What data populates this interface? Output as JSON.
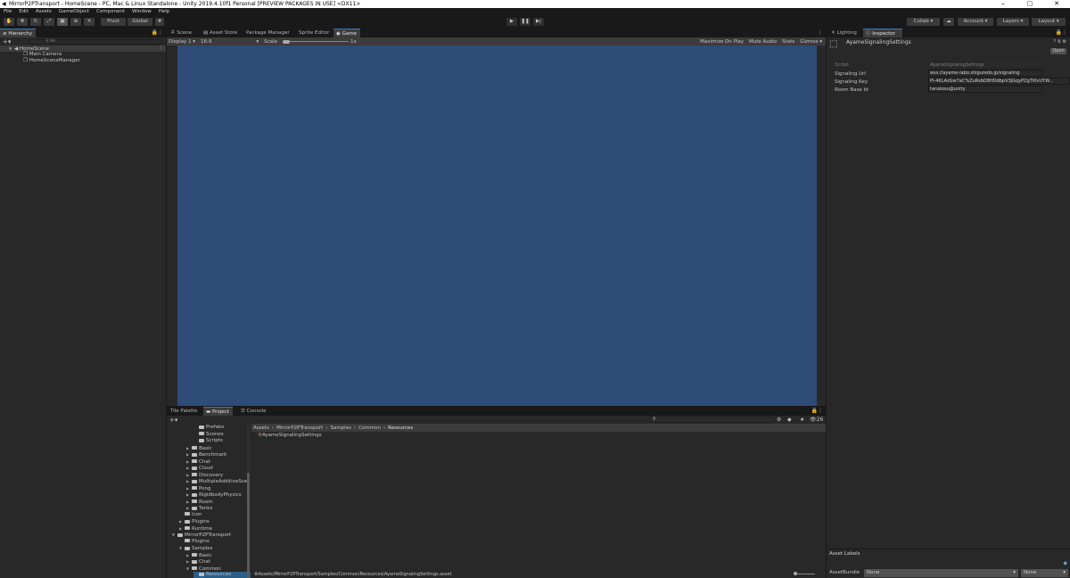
{
  "window": {
    "title": "MirrorP2PTransport - HomeScene - PC, Mac & Linux Standalone - Unity 2019.4.10f1 Personal [PREVIEW PACKAGES IN USE] <DX11>",
    "minimize": "‒",
    "maximize": "▢",
    "close": "✕"
  },
  "menu": [
    "File",
    "Edit",
    "Assets",
    "GameObject",
    "Component",
    "Window",
    "Help"
  ],
  "toolbar": {
    "pivot": "Pivot",
    "global": "Global",
    "collab": "Collab ▾",
    "account": "Account",
    "layers": "Layers",
    "layout": "Layout"
  },
  "hierarchy": {
    "tab": "Hierarchy",
    "search_placeholder": "All",
    "scene": "HomeScene",
    "items": [
      "Main Camera",
      "HomeSceneManager"
    ]
  },
  "center": {
    "tabs": [
      "Scene",
      "Asset Store",
      "Package Manager",
      "Sprite Editor",
      "Game"
    ],
    "display": "Display 1",
    "aspect": "16:9",
    "scale_label": "Scale",
    "scale_value": "1x",
    "options": [
      "Maximize On Play",
      "Mute Audio",
      "Stats",
      "Gizmos"
    ],
    "game_color": "#2f4b77"
  },
  "bottom": {
    "tabs": [
      "Tile Palette",
      "Project",
      "Console"
    ],
    "breadcrumb": [
      "Assets",
      "MirrorP2PTransport",
      "Samples",
      "Common",
      "Resources"
    ],
    "asset_item": "AyameSignalingSettings",
    "path": "Assets/MirrorP2PTransport/Samples/Common/Resources/AyameSignalingSettings.asset",
    "count": "26",
    "tree": [
      {
        "label": "Prefabs",
        "indent": 3,
        "arrow": ""
      },
      {
        "label": "Scenes",
        "indent": 3,
        "arrow": ""
      },
      {
        "label": "Scripts",
        "indent": 3,
        "arrow": ""
      },
      {
        "label": "Basic",
        "indent": 2,
        "arrow": "▶"
      },
      {
        "label": "Benchmark",
        "indent": 2,
        "arrow": "▶"
      },
      {
        "label": "Chat",
        "indent": 2,
        "arrow": "▶"
      },
      {
        "label": "Cloud",
        "indent": 2,
        "arrow": "▶"
      },
      {
        "label": "Discovery",
        "indent": 2,
        "arrow": "▶"
      },
      {
        "label": "MultipleAdditiveSce",
        "indent": 2,
        "arrow": "▶"
      },
      {
        "label": "Pong",
        "indent": 2,
        "arrow": "▶"
      },
      {
        "label": "RigidbodyPhysics",
        "indent": 2,
        "arrow": "▶"
      },
      {
        "label": "Room",
        "indent": 2,
        "arrow": "▶"
      },
      {
        "label": "Tanks",
        "indent": 2,
        "arrow": "▶"
      },
      {
        "label": "Icon",
        "indent": 1,
        "arrow": ""
      },
      {
        "label": "Plugins",
        "indent": 1,
        "arrow": "▶"
      },
      {
        "label": "Runtime",
        "indent": 1,
        "arrow": "▶"
      },
      {
        "label": "MirrorP2PTransport",
        "indent": 0,
        "arrow": "▼"
      },
      {
        "label": "Plugins",
        "indent": 1,
        "arrow": ""
      },
      {
        "label": "Samples",
        "indent": 1,
        "arrow": "▼"
      },
      {
        "label": "Basic",
        "indent": 2,
        "arrow": "▶"
      },
      {
        "label": "Chat",
        "indent": 2,
        "arrow": "▶"
      },
      {
        "label": "Common",
        "indent": 2,
        "arrow": "▼"
      },
      {
        "label": "Resources",
        "indent": 3,
        "arrow": ""
      }
    ]
  },
  "inspector": {
    "tabs": [
      "Lighting",
      "Inspector"
    ],
    "object_name": "AyameSignalingSettings",
    "open_button": "Open",
    "fields": [
      {
        "label": "Script",
        "value": "AyameSignalingSettings"
      },
      {
        "label": "Signaling Url",
        "value": "wss://ayame-labo.shiguredo.jp/signaling"
      },
      {
        "label": "Signaling Key",
        "value": "Pl-4KLAzGw7aC%ZuRsbD8HDdbpV3JGqyPZgTl0vUYW..."
      },
      {
        "label": "Room Base Id",
        "value": "tarukosu@unity"
      }
    ],
    "asset_labels": "Asset Labels",
    "asset_bundle_label": "AssetBundle",
    "asset_bundle_value": "None",
    "asset_variant_value": "None"
  }
}
